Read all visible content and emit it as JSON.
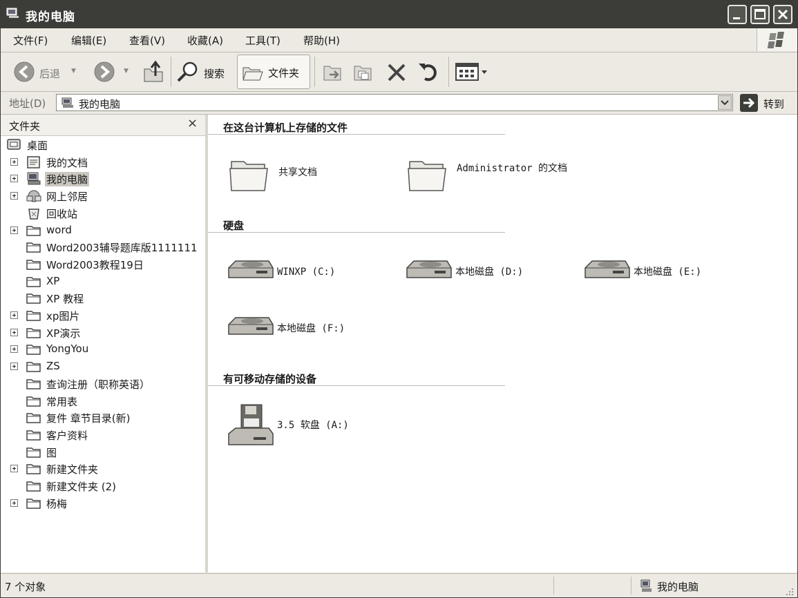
{
  "window": {
    "title": "我的电脑"
  },
  "menu": [
    "文件(F)",
    "编辑(E)",
    "查看(V)",
    "收藏(A)",
    "工具(T)",
    "帮助(H)"
  ],
  "toolbar": {
    "back": "后退",
    "search": "搜索",
    "folders": "文件夹"
  },
  "address": {
    "label": "地址(D)",
    "value": "我的电脑",
    "go": "转到"
  },
  "folders_pane": {
    "title": "文件夹",
    "close": "×",
    "items": [
      {
        "label": "桌面",
        "expandable": false,
        "level": 0,
        "icon": "desktop-icon"
      },
      {
        "label": "我的文档",
        "expandable": true,
        "level": 1,
        "icon": "my-documents-icon"
      },
      {
        "label": "我的电脑",
        "expandable": true,
        "level": 1,
        "icon": "my-computer-icon",
        "selected": true
      },
      {
        "label": "网上邻居",
        "expandable": true,
        "level": 1,
        "icon": "network-icon"
      },
      {
        "label": "回收站",
        "expandable": false,
        "level": 1,
        "icon": "recycle-bin-icon"
      },
      {
        "label": "word",
        "expandable": true,
        "level": 1,
        "icon": "folder-icon"
      },
      {
        "label": "Word2003辅导题库版1111111",
        "expandable": false,
        "level": 1,
        "icon": "folder-icon"
      },
      {
        "label": "Word2003教程19日",
        "expandable": false,
        "level": 1,
        "icon": "folder-icon"
      },
      {
        "label": "XP",
        "expandable": false,
        "level": 1,
        "icon": "folder-icon"
      },
      {
        "label": "XP   教程",
        "expandable": false,
        "level": 1,
        "icon": "folder-icon"
      },
      {
        "label": "xp图片",
        "expandable": true,
        "level": 1,
        "icon": "folder-icon"
      },
      {
        "label": "XP演示",
        "expandable": true,
        "level": 1,
        "icon": "folder-icon"
      },
      {
        "label": "YongYou",
        "expandable": true,
        "level": 1,
        "icon": "folder-icon"
      },
      {
        "label": "ZS",
        "expandable": true,
        "level": 1,
        "icon": "folder-icon"
      },
      {
        "label": "查询注册（职称英语）",
        "expandable": false,
        "level": 1,
        "icon": "folder-icon"
      },
      {
        "label": "常用表",
        "expandable": false,
        "level": 1,
        "icon": "folder-icon"
      },
      {
        "label": "复件 章节目录(新)",
        "expandable": false,
        "level": 1,
        "icon": "folder-icon"
      },
      {
        "label": "客户资料",
        "expandable": false,
        "level": 1,
        "icon": "folder-icon"
      },
      {
        "label": "图",
        "expandable": false,
        "level": 1,
        "icon": "folder-icon"
      },
      {
        "label": "新建文件夹",
        "expandable": true,
        "level": 1,
        "icon": "folder-icon"
      },
      {
        "label": "新建文件夹 (2)",
        "expandable": false,
        "level": 1,
        "icon": "folder-icon"
      },
      {
        "label": "杨梅",
        "expandable": true,
        "level": 1,
        "icon": "folder-icon"
      }
    ]
  },
  "content": {
    "sections": [
      {
        "title": "在这台计算机上存储的文件",
        "items": [
          {
            "name": "共享文档",
            "icon": "shared-folder-icon"
          },
          {
            "name": "Administrator 的文档",
            "icon": "user-folder-icon"
          }
        ]
      },
      {
        "title": "硬盘",
        "items": [
          {
            "name": "WINXP (C:)",
            "icon": "hard-disk-icon"
          },
          {
            "name": "本地磁盘 (D:)",
            "icon": "hard-disk-icon"
          },
          {
            "name": "本地磁盘 (E:)",
            "icon": "hard-disk-icon"
          },
          {
            "name": "本地磁盘 (F:)",
            "icon": "hard-disk-icon"
          }
        ]
      },
      {
        "title": "有可移动存储的设备",
        "items": [
          {
            "name": "3.5 软盘 (A:)",
            "icon": "floppy-drive-icon"
          }
        ]
      }
    ]
  },
  "status": {
    "left": "7 个对象",
    "right": "我的电脑"
  }
}
